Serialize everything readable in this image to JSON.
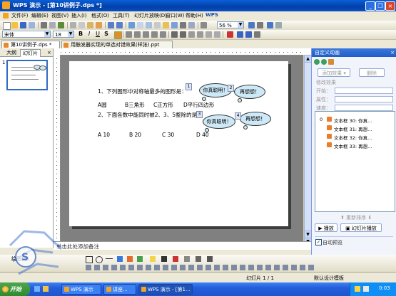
{
  "window": {
    "title": "WPS 演示 - [第10讲例子.dps *]",
    "minimize": "_",
    "restore": "❐",
    "close": "×"
  },
  "menu": {
    "items": [
      "文件(F)",
      "编辑(E)",
      "视图(V)",
      "插入(I)",
      "格式(O)",
      "工具(T)",
      "幻灯片放映(D)",
      "窗口(W)",
      "帮助(H)"
    ],
    "product": "WPS"
  },
  "toolbar": {
    "zoom": "56 %",
    "font_name": "宋体",
    "font_size": "18",
    "bold": "B",
    "italic": "I",
    "underline": "U",
    "shadow": "S"
  },
  "tabs": [
    {
      "label": "第10讲例子.dps *",
      "active": true
    },
    {
      "label": "用触发器实现的单选对错效果(样张).ppt",
      "active": false
    }
  ],
  "outline_pane": {
    "tab_outline": "大纲",
    "tab_slides": "幻灯片",
    "slide_number": "1"
  },
  "slide": {
    "question1": "1、下列图形中对称轴最多的图形是：",
    "q1_options": [
      "A圆",
      "B三角形",
      "C正方形",
      "D平行四边形"
    ],
    "question2": "2、下面各数中能同时被2、3、5整除的是：",
    "q2_options": [
      "A 10",
      "B 20",
      "C 30",
      "D 40"
    ],
    "callouts": [
      {
        "text": "你真聪明！",
        "num": "1"
      },
      {
        "text": "再想想！",
        "num": "2"
      },
      {
        "text": "你真聪明！",
        "num": "3"
      },
      {
        "text": "再想想！",
        "num": "4"
      }
    ]
  },
  "notes": {
    "placeholder": "单击此处添加备注"
  },
  "task_pane": {
    "title": "自定义动画",
    "add_effect": "添加效果",
    "remove": "删除",
    "section": "修改效果",
    "start_label": "开始：",
    "property_label": "属性：",
    "speed_label": "速度：",
    "list": [
      {
        "num": "0",
        "text": "文本框 30: 你真..."
      },
      {
        "text": "文本框 31: 再想..."
      },
      {
        "text": "文本框 32: 你真..."
      },
      {
        "text": "文本框 33: 再想..."
      }
    ],
    "reorder": "重新排序",
    "play": "播放",
    "slideshow": "幻灯片播放",
    "autopreview": "自动预览"
  },
  "status": {
    "slide_info": "幻灯片 1 / 1",
    "template": "默认设计模板"
  },
  "drawing": {
    "draw_label": "绘图(R)"
  },
  "taskbar": {
    "start": "开始",
    "tasks": [
      "WPS 演示",
      "讲座...",
      "WPS 演示 - [第1..."
    ],
    "clock": "0:03"
  },
  "colors": {
    "titlebar": "#0a5fd8",
    "callout_fill": "#cde8f6",
    "taskpane_head": "#3a78de",
    "taskbar": "#245edb",
    "start": "#3c9a3c"
  }
}
